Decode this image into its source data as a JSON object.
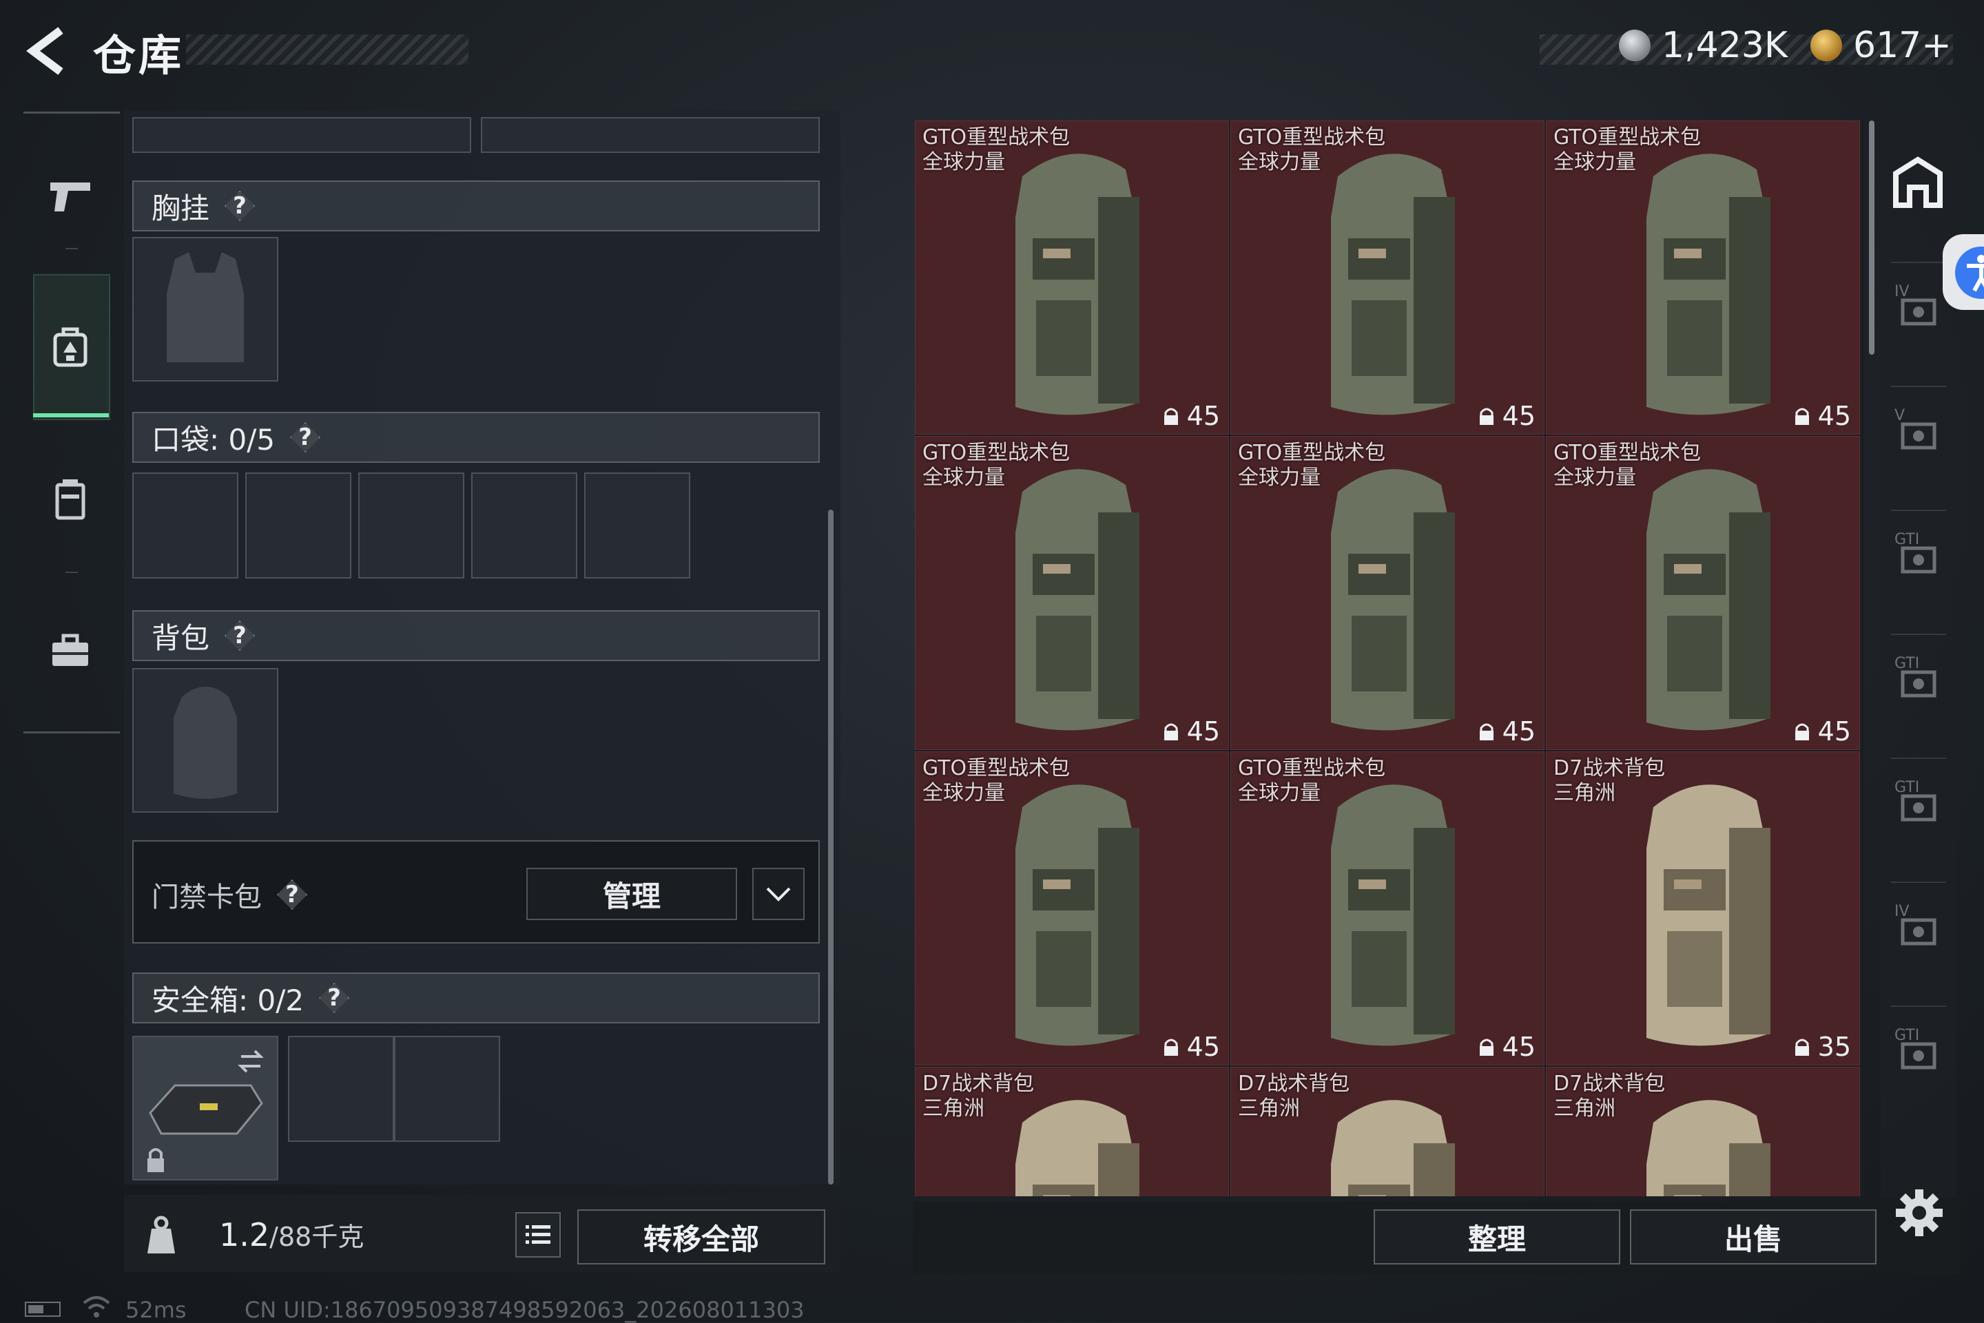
{
  "header": {
    "title": "仓库"
  },
  "currency": [
    {
      "value": "1,423K",
      "icon": "silver-coin-icon"
    },
    {
      "value": "617+",
      "icon": "gold-coin-icon"
    }
  ],
  "nav": [
    {
      "name": "weapons",
      "icon": "pistol-icon"
    },
    {
      "name": "gear",
      "icon": "backpack-icon",
      "active": true
    },
    {
      "name": "consumables",
      "icon": "canister-icon"
    },
    {
      "name": "toolbox",
      "icon": "briefcase-icon"
    }
  ],
  "slots": {
    "chest": {
      "label": "胸挂",
      "help": "?"
    },
    "pockets": {
      "label": "口袋: 0/5",
      "help": "?"
    },
    "backpack": {
      "label": "背包",
      "help": "?"
    },
    "card_pack": {
      "label": "门禁卡包",
      "help": "?",
      "manage_label": "管理"
    },
    "safe_box": {
      "label": "安全箱: 0/2",
      "help": "?"
    }
  },
  "capacity": {
    "value": "1.2",
    "max": "/88千克"
  },
  "buttons": {
    "transfer_all": "转移全部",
    "sort": "整理",
    "sell": "出售"
  },
  "status": {
    "ping": "52ms",
    "uid": "CN UID:1867095093874985920​63_202608011303"
  },
  "inventory": [
    {
      "name_line1": "GTO重型战术包",
      "name_line2": "全球力量",
      "capacity": "45",
      "variant": "green"
    },
    {
      "name_line1": "GTO重型战术包",
      "name_line2": "全球力量",
      "capacity": "45",
      "variant": "green"
    },
    {
      "name_line1": "GTO重型战术包",
      "name_line2": "全球力量",
      "capacity": "45",
      "variant": "green"
    },
    {
      "name_line1": "GTO重型战术包",
      "name_line2": "全球力量",
      "capacity": "45",
      "variant": "green"
    },
    {
      "name_line1": "GTO重型战术包",
      "name_line2": "全球力量",
      "capacity": "45",
      "variant": "green"
    },
    {
      "name_line1": "GTO重型战术包",
      "name_line2": "全球力量",
      "capacity": "45",
      "variant": "green"
    },
    {
      "name_line1": "GTO重型战术包",
      "name_line2": "全球力量",
      "capacity": "45",
      "variant": "green"
    },
    {
      "name_line1": "GTO重型战术包",
      "name_line2": "全球力量",
      "capacity": "45",
      "variant": "green"
    },
    {
      "name_line1": "D7战术背包",
      "name_line2": "三角洲",
      "capacity": "35",
      "variant": "tan"
    },
    {
      "name_line1": "D7战术背包",
      "name_line2": "三角洲",
      "capacity": "",
      "variant": "tan"
    },
    {
      "name_line1": "D7战术背包",
      "name_line2": "三角洲",
      "capacity": "",
      "variant": "tan"
    },
    {
      "name_line1": "D7战术背包",
      "name_line2": "三角洲",
      "capacity": "",
      "variant": "tan"
    }
  ],
  "colors": {
    "cell_bg": "#4a2327",
    "active_accent": "#6fe3a9",
    "accessibility": "#3a7af0"
  },
  "right_rail": [
    {
      "icon": "home-icon"
    },
    {
      "icon": "armor-iv-icon"
    },
    {
      "icon": "helmet-v-icon"
    },
    {
      "icon": "rig-gti-icon"
    },
    {
      "icon": "rig-gti-icon"
    },
    {
      "icon": "rig-gti-icon"
    },
    {
      "icon": "medkit-iv-icon"
    },
    {
      "icon": "rig-gti-icon"
    }
  ]
}
